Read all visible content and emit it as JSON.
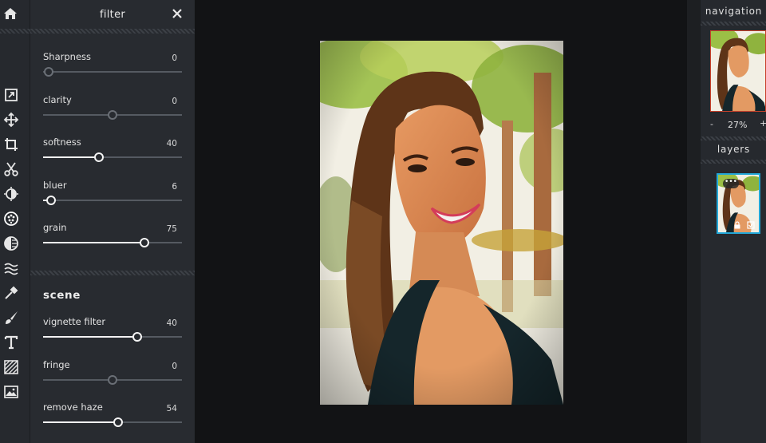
{
  "panel": {
    "title": "filter",
    "close_icon": "close-icon"
  },
  "sliders": [
    {
      "label": "Sharpness",
      "value": "0",
      "fraction": 0.04
    },
    {
      "label": "clarity",
      "value": "0",
      "fraction": 0.5
    },
    {
      "label": "softness",
      "value": "40",
      "fraction": 0.4
    },
    {
      "label": "bluer",
      "value": "6",
      "fraction": 0.06
    },
    {
      "label": "grain",
      "value": "75",
      "fraction": 0.73
    }
  ],
  "scene": {
    "heading": "scene",
    "sliders": [
      {
        "label": "vignette filter",
        "value": "40",
        "fraction": 0.68
      },
      {
        "label": "fringe",
        "value": "0",
        "fraction": 0.5
      },
      {
        "label": "remove haze",
        "value": "54",
        "fraction": 0.54
      }
    ]
  },
  "toolbar": {
    "icons": [
      "home-icon",
      "export-icon",
      "move-icon",
      "crop-icon",
      "cut-icon",
      "adjust-icon",
      "filter-icon",
      "effect-icon",
      "distort-icon",
      "color-picker-icon",
      "brush-icon",
      "text-icon",
      "pattern-icon",
      "image-icon"
    ]
  },
  "right_panel": {
    "navigation_heading": "navigation",
    "zoom_minus": "-",
    "zoom_value": "27%",
    "zoom_plus": "+",
    "layers_heading": "layers",
    "layer_menu": "•••"
  },
  "colors": {
    "accent_layer": "#22a7d8",
    "nav_border": "#c7412b",
    "panel_bg": "#282b30",
    "canvas_bg": "#121315"
  }
}
